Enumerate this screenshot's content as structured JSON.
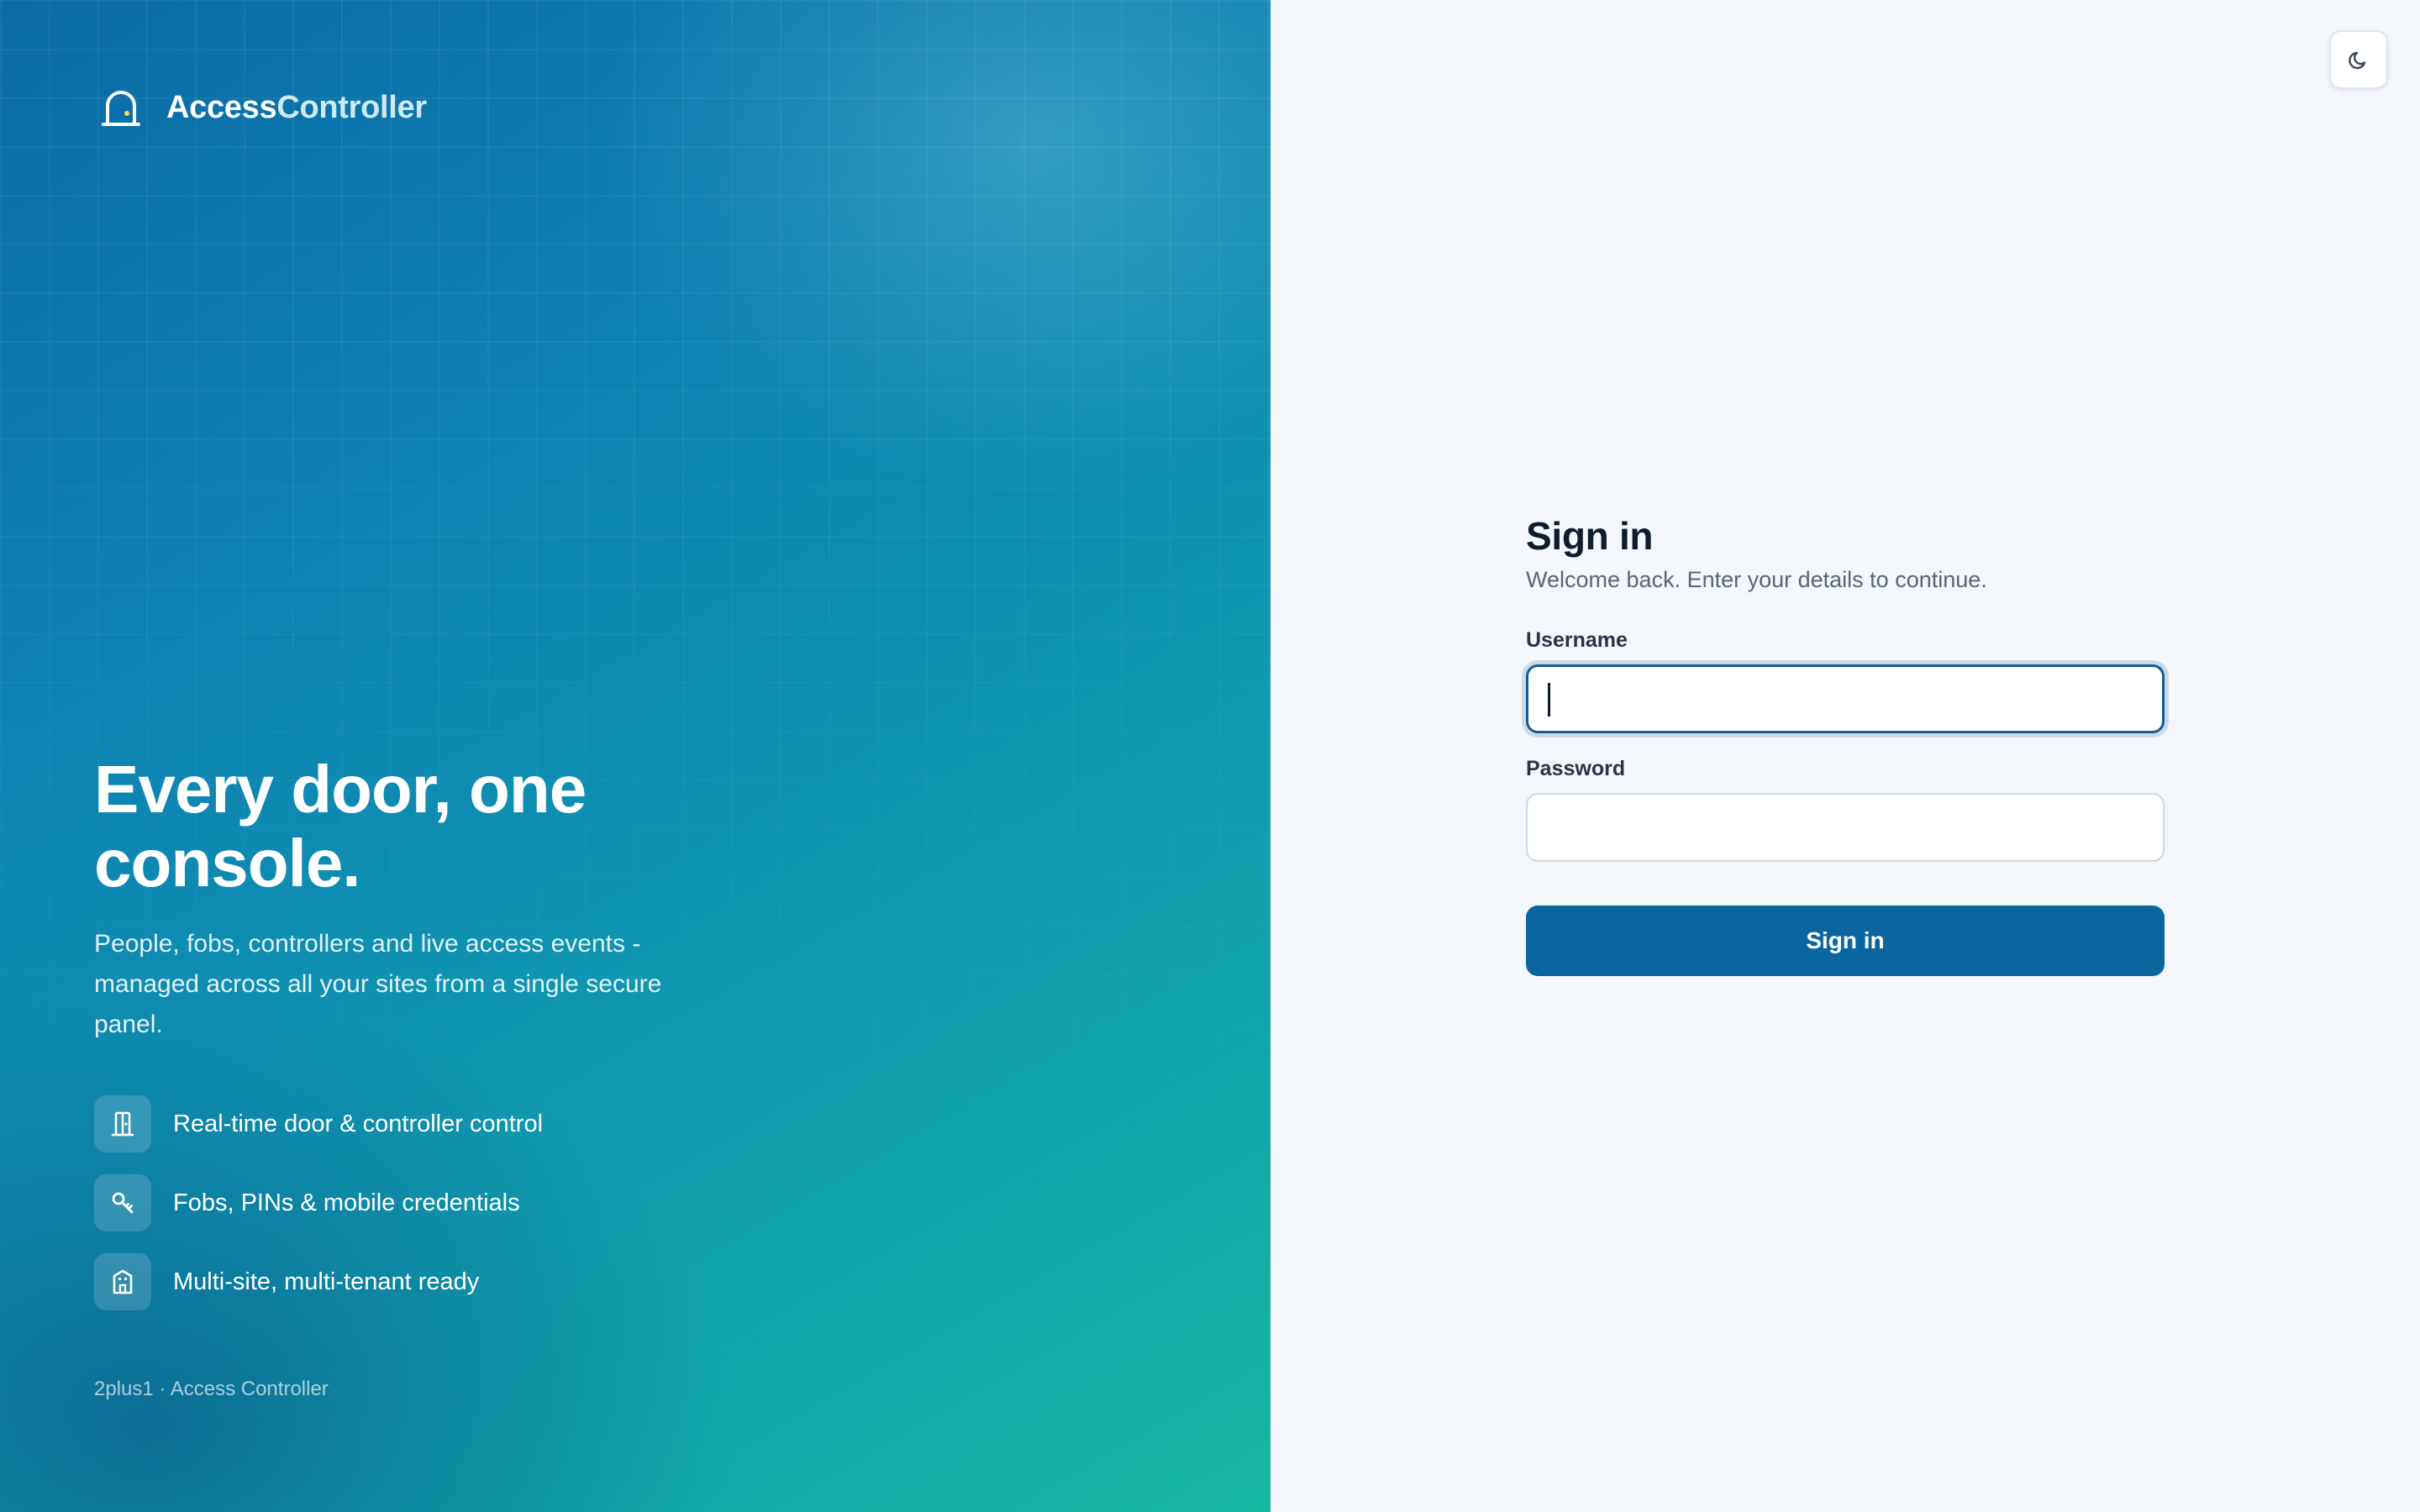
{
  "brand": {
    "name_part1": "Access",
    "name_part2": "Controller",
    "logo_icon": "door-arch-icon"
  },
  "hero": {
    "headline": "Every door, one console.",
    "tagline": "People, fobs, controllers and live access events - managed across all your sites from a single secure panel.",
    "features": [
      {
        "icon": "door-icon",
        "label": "Real-time door & controller control"
      },
      {
        "icon": "key-icon",
        "label": "Fobs, PINs & mobile credentials"
      },
      {
        "icon": "building-icon",
        "label": "Multi-site, multi-tenant ready"
      }
    ],
    "footer": "2plus1 · Access Controller"
  },
  "theme_toggle": {
    "icon": "moon-icon"
  },
  "signin": {
    "title": "Sign in",
    "subtitle": "Welcome back. Enter your details to continue.",
    "username_label": "Username",
    "username_value": "",
    "password_label": "Password",
    "password_value": "",
    "submit_label": "Sign in"
  },
  "colors": {
    "accent": "#0b66a0",
    "hero_gradient_start": "#0a6aa5",
    "hero_gradient_end": "#16b8a1",
    "panel_background": "#f3f6fa"
  }
}
